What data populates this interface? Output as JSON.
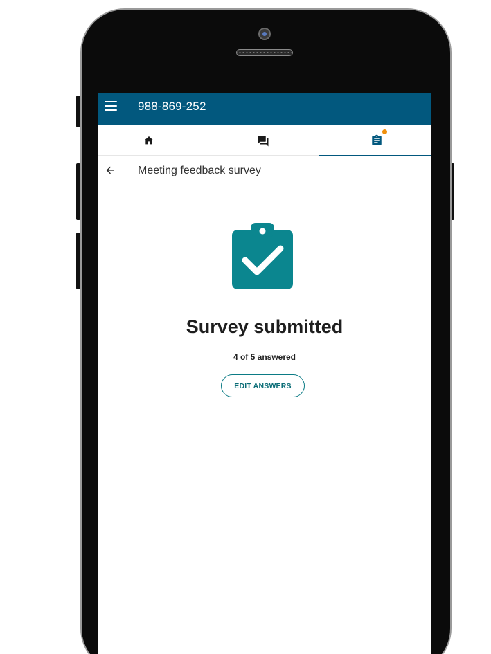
{
  "app_bar": {
    "menu_icon": "hamburger-menu-icon",
    "meeting_id": "988-869-252",
    "background": "#02587e"
  },
  "tabs": [
    {
      "icon": "home-icon",
      "active": false
    },
    {
      "icon": "chat-icon",
      "active": false
    },
    {
      "icon": "survey-clipboard-icon",
      "active": true,
      "notification": true
    }
  ],
  "subheader": {
    "back_icon": "arrow-back-icon",
    "title": "Meeting feedback survey"
  },
  "main": {
    "status_icon": "clipboard-check-icon",
    "status_title": "Survey submitted",
    "answered_text": "4 of 5 answered",
    "edit_button_label": "EDIT ANSWERS"
  },
  "colors": {
    "accent": "#02587e",
    "teal": "#0b868f",
    "notification": "#f0900c"
  }
}
